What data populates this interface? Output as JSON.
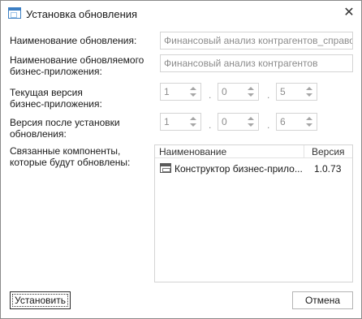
{
  "window": {
    "title": "Установка обновления",
    "close_glyph": "✕"
  },
  "form": {
    "update_name_label": "Наименование обновления:",
    "update_name_value": "Финансовый анализ контрагентов_справочни",
    "app_name_label_line1": "Наименование обновляемого",
    "app_name_label_line2": "бизнес-приложения:",
    "app_name_value": "Финансовый анализ контрагентов",
    "current_version_label_line1": "Текущая версия",
    "current_version_label_line2": "бизнес-приложения:",
    "current_version": [
      "1",
      "0",
      "5"
    ],
    "new_version_label_line1": "Версия после установки",
    "new_version_label_line2": "обновления:",
    "new_version": [
      "1",
      "0",
      "6"
    ],
    "version_separator": ".",
    "components_label_line1": "Связанные компоненты,",
    "components_label_line2": "которые будут обновлены:"
  },
  "components_grid": {
    "columns": [
      "Наименование",
      "Версия"
    ],
    "rows": [
      {
        "name": "Конструктор бизнес-прило...",
        "version": "1.0.73",
        "icon": "component-icon"
      }
    ]
  },
  "buttons": {
    "install": "Установить",
    "cancel": "Отмена"
  }
}
